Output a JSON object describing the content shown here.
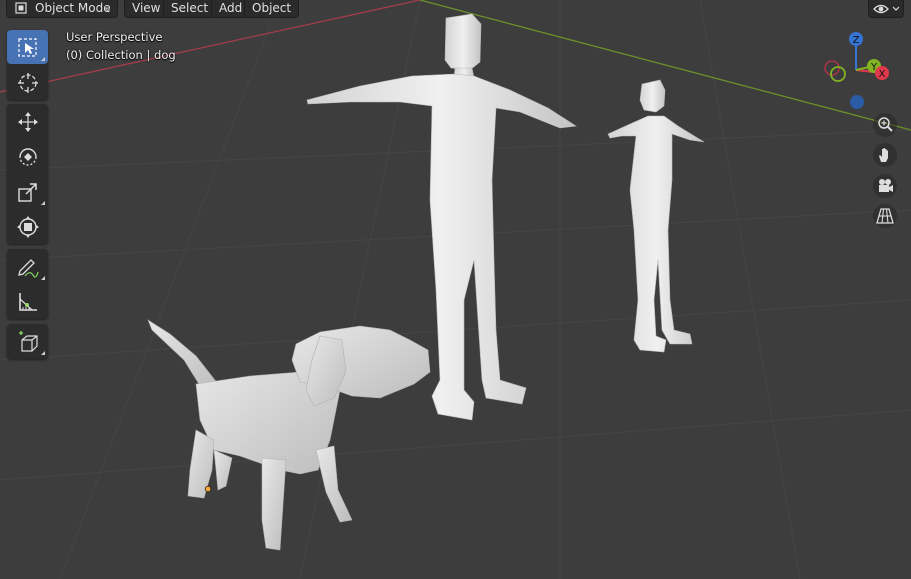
{
  "header": {
    "mode_label": "Object Mode",
    "menus": [
      "View",
      "Select",
      "Add",
      "Object"
    ]
  },
  "overlay": {
    "view_name": "User Perspective",
    "collection_info": "(0) Collection | dog"
  },
  "gizmo": {
    "z_label": "Z",
    "y_label": "Y",
    "x_label": "X"
  },
  "toolbar": {
    "tools": [
      "select-box",
      "cursor",
      "move",
      "rotate",
      "scale",
      "transform",
      "annotate",
      "measure",
      "add-cube"
    ],
    "active_tool": "select-box"
  },
  "navigation": {
    "buttons": [
      "zoom",
      "pan",
      "camera-view",
      "perspective-toggle"
    ]
  },
  "scene": {
    "objects": [
      "dog",
      "man",
      "woman"
    ],
    "active_object": "dog"
  },
  "colors": {
    "viewport_bg": "#3d3d3d",
    "grid_line": "#474747",
    "x_axis": "#a33d4a",
    "y_axis": "#6c8f2c",
    "mesh": "#d9d9d9",
    "gizmo_x": "#e0394c",
    "gizmo_y": "#82b322",
    "gizmo_z": "#3474d4",
    "active_tool": "#4772b3"
  }
}
